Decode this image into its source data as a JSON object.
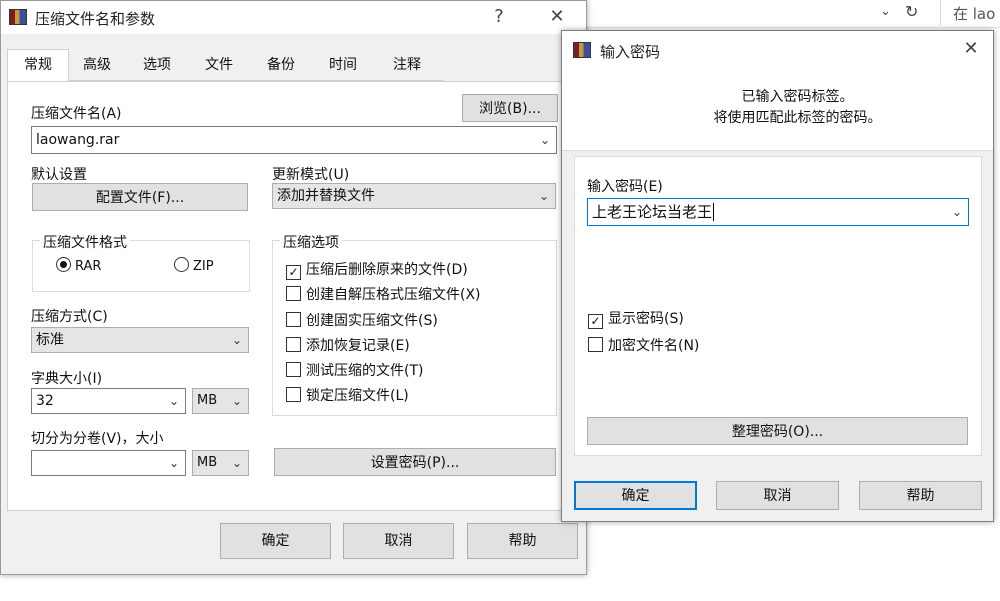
{
  "topbar": {
    "refresh_icon": "↻",
    "search_text": "在 lao"
  },
  "main_window": {
    "title": "压缩文件名和参数",
    "help_glyph": "?",
    "close_glyph": "✕",
    "tabs": [
      "常规",
      "高级",
      "选项",
      "文件",
      "备份",
      "时间",
      "注释"
    ],
    "archive_name_label": "压缩文件名(A)",
    "browse_button": "浏览(B)...",
    "archive_name_value": "laowang.rar",
    "default_settings_label": "默认设置",
    "profiles_button": "配置文件(F)...",
    "update_mode_label": "更新模式(U)",
    "update_mode_value": "添加并替换文件",
    "format_group_label": "压缩文件格式",
    "format_rar": "RAR",
    "format_zip": "ZIP",
    "options_group_label": "压缩选项",
    "options": [
      {
        "label": "压缩后删除原来的文件(D)",
        "checked": true
      },
      {
        "label": "创建自解压格式压缩文件(X)",
        "checked": false
      },
      {
        "label": "创建固实压缩文件(S)",
        "checked": false
      },
      {
        "label": "添加恢复记录(E)",
        "checked": false
      },
      {
        "label": "测试压缩的文件(T)",
        "checked": false
      },
      {
        "label": "锁定压缩文件(L)",
        "checked": false
      }
    ],
    "method_label": "压缩方式(C)",
    "method_value": "标准",
    "dict_label": "字典大小(I)",
    "dict_value": "32",
    "dict_unit": "MB",
    "split_label": "切分为分卷(V)，大小",
    "split_value": "",
    "split_unit": "MB",
    "set_password_button": "设置密码(P)...",
    "ok_button": "确定",
    "cancel_button": "取消",
    "help_button": "帮助"
  },
  "password_dialog": {
    "title": "输入密码",
    "close_glyph": "✕",
    "info_line1": "已输入密码标签。",
    "info_line2": "将使用匹配此标签的密码。",
    "enter_label": "输入密码(E)",
    "password_value": "上老王论坛当老王",
    "show_password": {
      "label": "显示密码(S)",
      "checked": true
    },
    "encrypt_names": {
      "label": "加密文件名(N)",
      "checked": false
    },
    "organize_button": "整理密码(O)...",
    "ok_button": "确定",
    "cancel_button": "取消",
    "help_button": "帮助"
  }
}
